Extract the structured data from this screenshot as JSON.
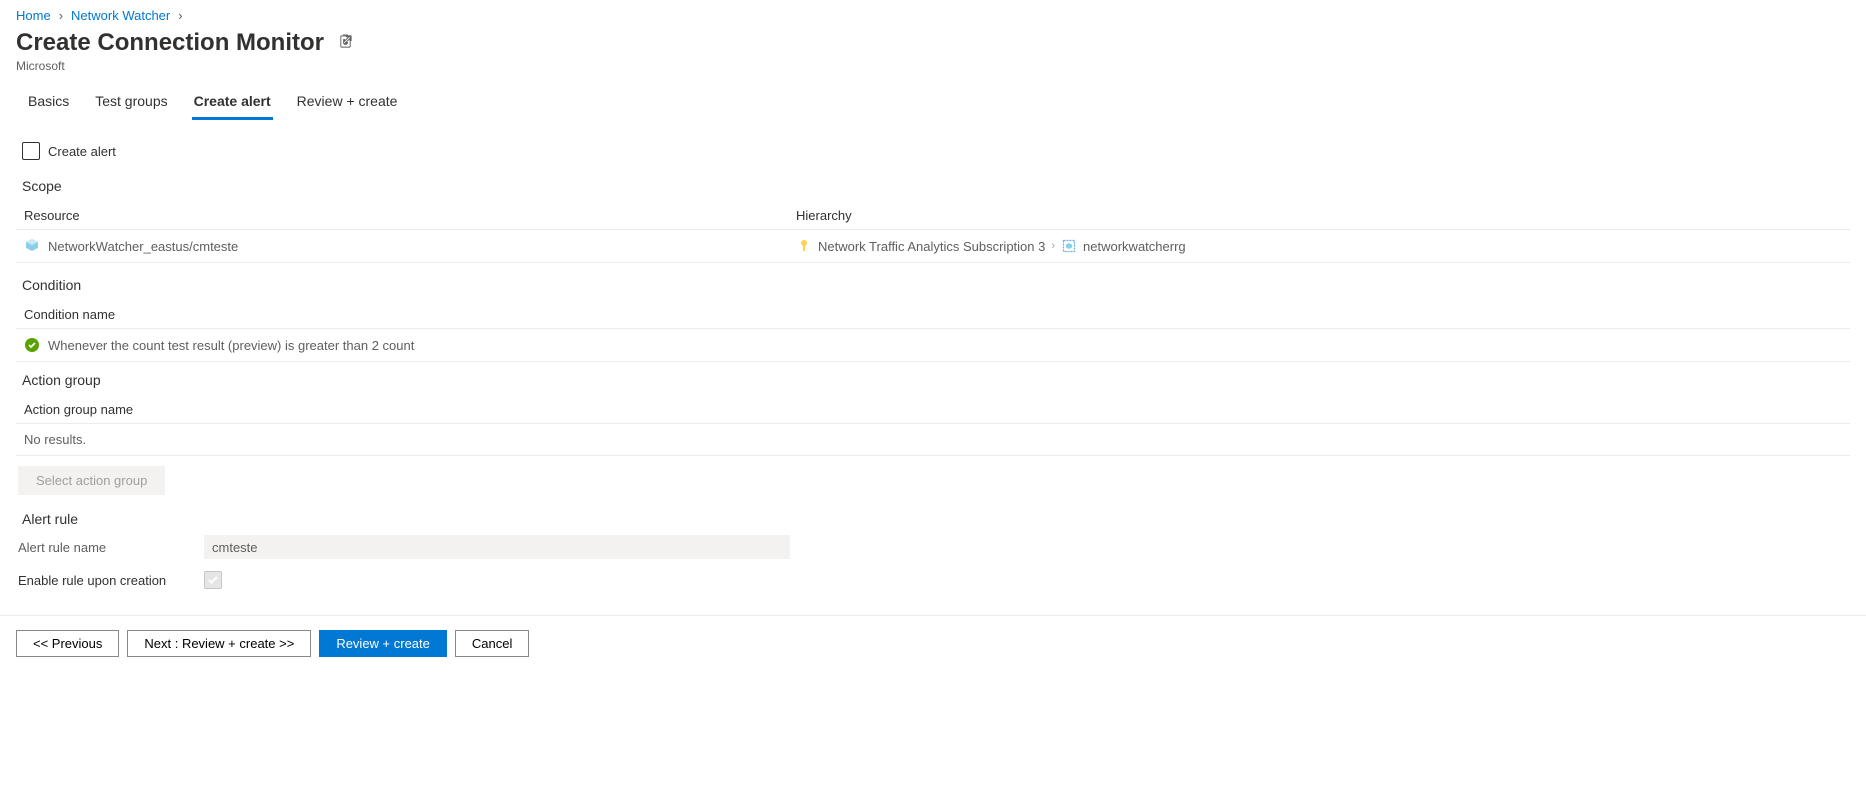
{
  "breadcrumb": {
    "home": "Home",
    "network_watcher": "Network Watcher"
  },
  "title": "Create Connection Monitor",
  "subtitle": "Microsoft",
  "tabs": {
    "basics": "Basics",
    "test_groups": "Test groups",
    "create_alert": "Create alert",
    "review_create": "Review + create"
  },
  "create_alert_checkbox": "Create alert",
  "scope": {
    "label": "Scope",
    "headers": {
      "resource": "Resource",
      "hierarchy": "Hierarchy"
    },
    "resource": "NetworkWatcher_eastus/cmteste",
    "hierarchy": {
      "subscription": "Network Traffic Analytics Subscription 3",
      "rg": "networkwatcherrg"
    }
  },
  "condition": {
    "label": "Condition",
    "header": "Condition name",
    "text": "Whenever the count test result (preview) is greater than 2 count"
  },
  "action_group": {
    "label": "Action group",
    "header": "Action group name",
    "empty": "No results.",
    "select_btn": "Select action group"
  },
  "alert_rule": {
    "label": "Alert rule",
    "name_label": "Alert rule name",
    "name_value": "cmteste",
    "enable_label": "Enable rule upon creation"
  },
  "footer": {
    "previous": "<< Previous",
    "next": "Next : Review + create >>",
    "review": "Review + create",
    "cancel": "Cancel"
  }
}
